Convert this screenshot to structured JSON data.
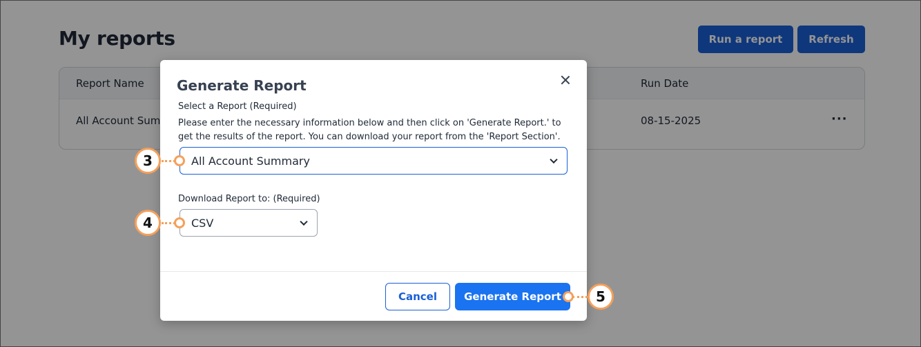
{
  "page": {
    "title": "My reports",
    "run_report_label": "Run a report",
    "refresh_label": "Refresh"
  },
  "table": {
    "columns": [
      "Report Name",
      "Run Date"
    ],
    "rows": [
      {
        "report_name": "All Account Sum",
        "run_date": "08-15-2025",
        "actions": "···"
      }
    ]
  },
  "modal": {
    "title": "Generate Report",
    "select_report_label": "Select a Report  (Required)",
    "description": "Please enter the necessary information below and then click on 'Generate Report.' to get the results of the report. You can download your report from the 'Report Section'.",
    "report_select_value": "All Account Summary",
    "download_label": "Download Report to:  (Required)",
    "download_select_value": "CSV",
    "cancel_label": "Cancel",
    "generate_label": "Generate Report"
  },
  "callouts": [
    "3",
    "4",
    "5"
  ],
  "colors": {
    "primary": "#1a5fd6",
    "generate": "#1a73f0",
    "callout": "#f5a05a"
  }
}
